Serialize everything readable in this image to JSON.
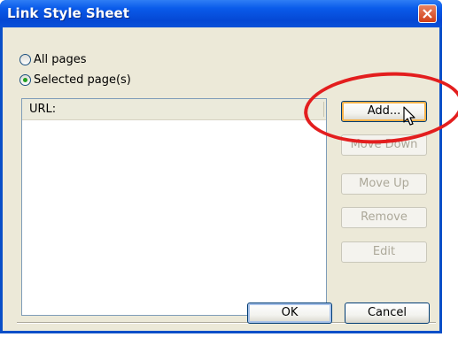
{
  "window": {
    "title": "Link Style Sheet",
    "close_glyph": "✕"
  },
  "scope": {
    "all_pages_label": "All pages",
    "selected_pages_label": "Selected page(s)",
    "selected": "selected_pages"
  },
  "list": {
    "column_header": "URL:",
    "rows": []
  },
  "side_buttons": {
    "add": "Add...",
    "move_down": "Move Down",
    "move_up": "Move Up",
    "remove": "Remove",
    "edit": "Edit"
  },
  "footer": {
    "ok": "OK",
    "cancel": "Cancel"
  },
  "colors": {
    "titlebar": "#0a5bea",
    "dialog_bg": "#ece9d8",
    "highlight_ring": "#e31e1e",
    "radio_dot": "#21a121"
  },
  "icons": {
    "close": "close-icon",
    "cursor": "mouse-pointer-icon"
  }
}
